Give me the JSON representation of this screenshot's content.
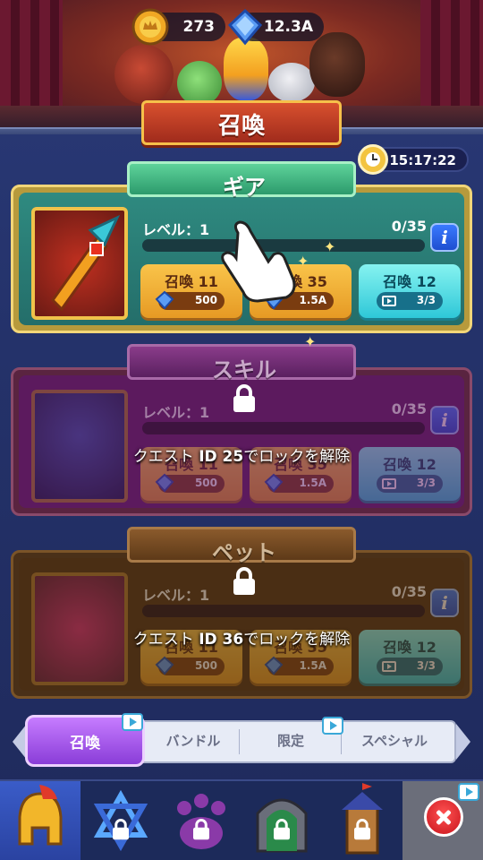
{
  "header": {
    "gold": "273",
    "gems": "12.3A",
    "title": "召喚"
  },
  "timer": "15:17:22",
  "cards": {
    "gear": {
      "tab": "ギア",
      "level": "レベル：1",
      "count": "0/35",
      "info": "i",
      "buttons": [
        {
          "label": "召喚 11",
          "cost": "500",
          "icon": "gem-icon"
        },
        {
          "label": "召喚 35",
          "cost": "1.5A",
          "icon": "gem-icon"
        },
        {
          "label": "召喚 12",
          "cost": "3/3",
          "icon": "video-icon"
        }
      ]
    },
    "skill": {
      "tab": "スキル",
      "level": "レベル：1",
      "count": "0/35",
      "info": "i",
      "lock_msg_pre": "クエスト ",
      "lock_msg_id": "ID 25",
      "lock_msg_post": "でロックを解除",
      "buttons": [
        {
          "label": "召喚 11",
          "cost": "500"
        },
        {
          "label": "召喚 35",
          "cost": "1.5A"
        },
        {
          "label": "召喚 12",
          "cost": "3/3"
        }
      ]
    },
    "pet": {
      "tab": "ペット",
      "level": "レベル：1",
      "count": "0/35",
      "info": "i",
      "lock_msg_pre": "クエスト ",
      "lock_msg_id": "ID 36",
      "lock_msg_post": "でロックを解除",
      "buttons": [
        {
          "label": "召喚 11",
          "cost": "500"
        },
        {
          "label": "召喚 35",
          "cost": "1.5A"
        },
        {
          "label": "召喚 12",
          "cost": "3/3"
        }
      ]
    }
  },
  "subtabs": [
    "召喚",
    "バンドル",
    "限定",
    "スペシャル"
  ],
  "colors": {
    "accent": "#8a3dd8",
    "gear": "#2f8a80",
    "skill": "#5c1a5e",
    "pet": "#4a2e14"
  }
}
